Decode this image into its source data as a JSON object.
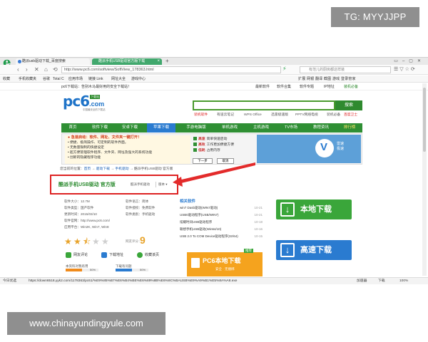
{
  "overlays": {
    "tg": "TG: MYYJJPP",
    "watermark": "www.chinayundingyule.com"
  },
  "browser": {
    "tabs": [
      {
        "label": "酷派usb驱动下载_百度搜索"
      },
      {
        "label": "酷派手机USB驱动官方版下载"
      }
    ],
    "tab_add": "+",
    "address": "http://www.pc6.com/softview/SoftView_178363.html",
    "address_host": "www.pc6.com",
    "search_placeholder": "有范儿的厨房都这样装",
    "bookmarks": [
      "收藏",
      "手机收藏夹",
      "谷歌",
      "Total C",
      "应用市场",
      "链接 Link",
      "网址大全",
      "游戏中心"
    ],
    "bookmarks_right": "扩展  网银  翻译  截图  游戏  登录管家",
    "status_left": "今日优选",
    "status_url": "https://down6518.yyk2.com/1178363/pc61/%E9%85%B7%E6%B4%BE%E6%89%8B%E6%9C%BAUSB%E9%A9%B1%E5%8A%A8.exe",
    "status_right": [
      "加速器",
      "下载",
      "100%"
    ]
  },
  "site": {
    "top_left": "pc6下载站：告别木马最好用的安全下载站！",
    "top_right": [
      "最新软件",
      "软件合集",
      "软件专题",
      "IP地址",
      "装机必备"
    ],
    "logo_main": "pc6",
    "logo_com": ".com",
    "logo_tag": "下载站",
    "logo_sub": "中国最安全的下载站",
    "search_button": "搜索",
    "hot_links": [
      "装机软件",
      "有道云笔记",
      "WPS Office",
      "迅雷极速版",
      "PPTV网络电视",
      "装机必备",
      "百度卫士"
    ],
    "nav": [
      "首页",
      "软件下载",
      "安卓下载",
      "苹果下载",
      "手游电脑版",
      "单机游戏",
      "主机游戏",
      "TV市场",
      "教程资讯",
      "排行榜"
    ],
    "promo": {
      "line1": "● 急速启动：软件、网址、文件夹一键打开！",
      "lines": [
        "• 便捷、极简操作、可定制的软件界面。",
        "• 无数量限制的快捷设定",
        "• 超方便管理软件程序、文件夹、网址及强大的系统功能",
        "• 创新的隐藏程序功能"
      ],
      "checks": [
        {
          "k": "高速",
          "v": "简单快速启动"
        },
        {
          "k": "高效",
          "v": "工作更加便捷方便"
        },
        {
          "k": "低耗",
          "v": "占用内存"
        }
      ],
      "next": "下一步",
      "cancel": "取消",
      "brand_line1": "雷速",
      "brand_line2": "极速"
    },
    "breadcrumb_prefix": "您当前的位置：",
    "breadcrumb": [
      "首页",
      "驱动下载",
      "手机驱动",
      "酷派手机USB驱动 官方版"
    ],
    "title": "酷派手机USB驱动 官方版",
    "title_sub": "酷派手机驱动",
    "title_ver": "版本",
    "details": [
      [
        "软件大小：12.7M",
        "软件语言：简体"
      ],
      [
        "软件类型：国产软件",
        "软件授权：免费软件"
      ],
      [
        "更新时间：2015/03/10",
        "软件类别：手机驱动"
      ],
      [
        "软件官网：http://www.pc6.com/",
        ""
      ],
      [
        "应用平台：Win2K, Win7, Win8",
        ""
      ]
    ],
    "rating_label": "网友评分：",
    "rating": 2.5,
    "score": "9",
    "actions": [
      "网友评论",
      "下载地址",
      "收藏该页"
    ],
    "votes": [
      {
        "label": "本资料对我有用",
        "pct": "50%",
        "level": 0.5
      },
      {
        "label": "下载有问题",
        "pct": "50%",
        "level": 0.5
      }
    ],
    "related_title": "相关软件",
    "related": [
      {
        "name": "win7 Dasb驱动(WIN7驱动)",
        "date": "10-21"
      },
      {
        "name": "USB0驱动程序(USB/WIN7)",
        "date": "10-21"
      },
      {
        "name": "炫耀时间USB驱动程序",
        "date": "10-18"
      },
      {
        "name": "联想手机USB驱动(Win64/10)",
        "date": "10-16"
      },
      {
        "name": "USB 2.0 To COM Device驱动程序(32/64)",
        "date": "10-15"
      }
    ],
    "dl_local": "本地下载",
    "dl_fast": "高速下载",
    "banner_big": "PC6本地下载",
    "banner_small": "安全 · 无捆绑",
    "banner_tag": "推荐"
  }
}
